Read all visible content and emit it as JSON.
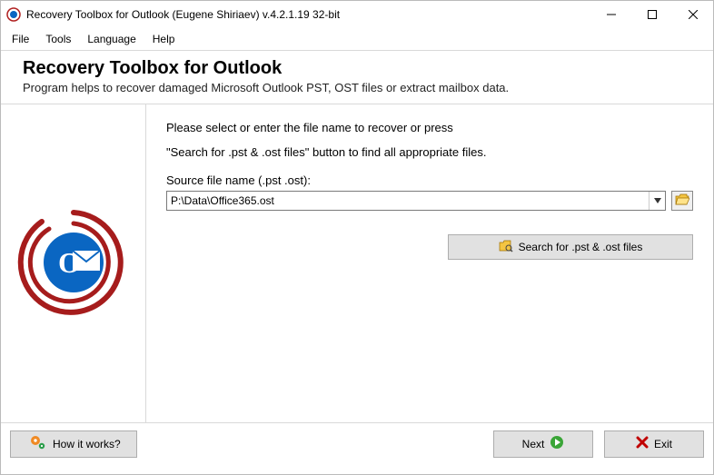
{
  "window": {
    "title": "Recovery Toolbox for Outlook (Eugene Shiriaev) v.4.2.1.19 32-bit"
  },
  "menu": {
    "file": "File",
    "tools": "Tools",
    "language": "Language",
    "help": "Help"
  },
  "header": {
    "title": "Recovery Toolbox for Outlook",
    "subtitle": "Program helps to recover damaged Microsoft Outlook PST, OST files or extract mailbox data."
  },
  "content": {
    "line1": "Please select or enter the file name to recover or press",
    "line2": "\"Search for .pst & .ost files\" button to find all appropriate files.",
    "source_label": "Source file name (.pst .ost):",
    "file_value": "P:\\Data\\Office365.ost",
    "search_button": "Search for .pst & .ost files"
  },
  "footer": {
    "how": "How it works?",
    "next": "Next",
    "exit": "Exit"
  }
}
